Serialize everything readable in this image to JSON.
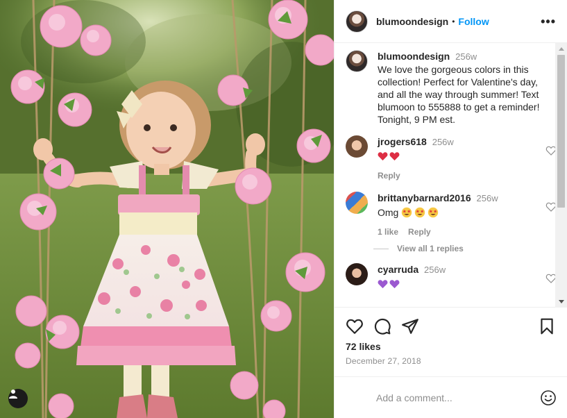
{
  "post": {
    "image_alt": "Toddler in floral dress holding flower-garland swing ropes",
    "user_tag_icon": "person-icon"
  },
  "header": {
    "username": "blumoondesign",
    "separator": "•",
    "follow_label": "Follow",
    "more_label": "•••"
  },
  "caption": {
    "username": "blumoondesign",
    "time": "256w",
    "text": "We love the gorgeous colors in this collection! Perfect for Valentine's day, and all the way through summer! Text blumoon to 555888 to get a reminder! Tonight, 9 PM est."
  },
  "comments": [
    {
      "username": "jrogers618",
      "time": "256w",
      "emoji": [
        "red-heart",
        "red-heart"
      ],
      "reply_label": "Reply"
    },
    {
      "username": "brittanybarnard2016",
      "time": "256w",
      "text": "Omg",
      "emoji": [
        "star-struck",
        "star-struck",
        "star-struck"
      ],
      "likes_label": "1 like",
      "reply_label": "Reply",
      "view_replies_label": "View all 1 replies"
    },
    {
      "username": "cyarruda",
      "time": "256w",
      "emoji": [
        "purple-heart",
        "purple-heart"
      ]
    }
  ],
  "actions": {
    "like_icon": "heart-icon",
    "comment_icon": "comment-icon",
    "share_icon": "paper-plane-icon",
    "save_icon": "bookmark-icon"
  },
  "likes_text": "72 likes",
  "date_text": "December 27, 2018",
  "add_comment": {
    "placeholder": "Add a comment...",
    "emoji_icon": "smiley-icon"
  },
  "colors": {
    "follow": "#0095f6",
    "text": "#262626",
    "muted": "#8e8e8e",
    "border": "#efefef"
  }
}
